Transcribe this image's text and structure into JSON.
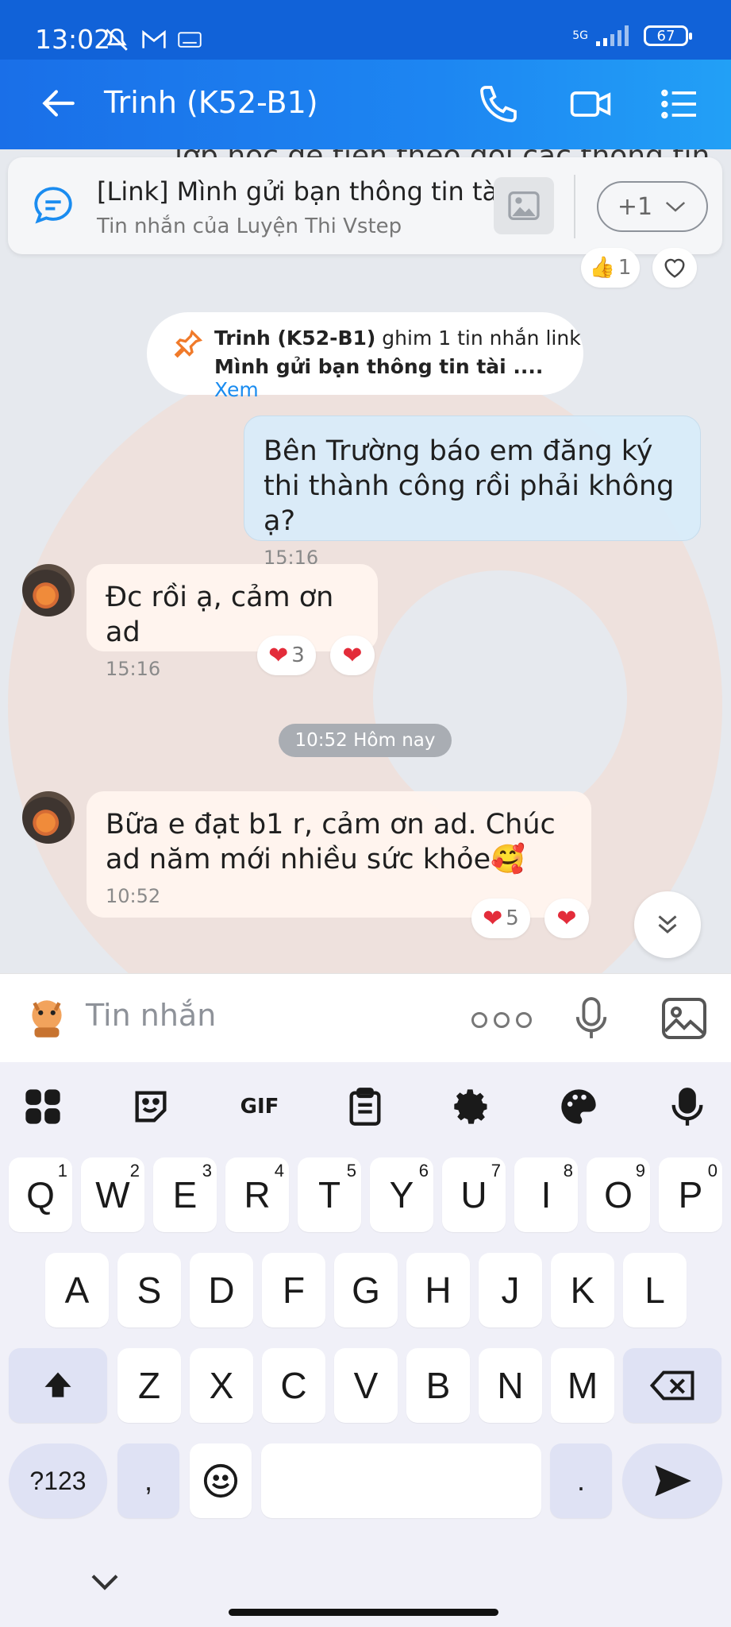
{
  "status_bar": {
    "time": "13:02",
    "network": "5G",
    "battery": "67"
  },
  "header": {
    "title": "Trinh (K52-B1)"
  },
  "chat": {
    "cut_off_text": "lớp học để tiện theo dõi các thông tin",
    "pinned": {
      "title": "[Link] Mình gửi bạn thông tin tà...",
      "subtitle": "Tin nhắn của Luyện Thi Vstep",
      "more_label": "+1"
    },
    "prev_reaction_count": "1",
    "pin_notice": {
      "actor": "Trinh (K52-B1)",
      "action": " ghim 1 tin nhắn link",
      "message": "Mình gửi bạn thông tin tài .... ",
      "link": "Xem"
    },
    "messages": [
      {
        "text": "Bên Trường báo em đăng ký thi thành công rồi phải không ạ?",
        "time": "15:16"
      },
      {
        "text": "Đc rồi ạ, cảm ơn ad",
        "time": "15:16",
        "reaction_count": "3"
      },
      {
        "text": "Bữa e đạt b1 r, cảm ơn ad. Chúc ad năm mới nhiều sức khỏe🥰",
        "time": "10:52",
        "reaction_count": "5"
      }
    ],
    "date_chip": "10:52 Hôm nay"
  },
  "composer": {
    "placeholder": "Tin nhắn"
  },
  "keyboard": {
    "toolbar": {
      "gif_label": "GIF"
    },
    "row1": [
      [
        "Q",
        "1"
      ],
      [
        "W",
        "2"
      ],
      [
        "E",
        "3"
      ],
      [
        "R",
        "4"
      ],
      [
        "T",
        "5"
      ],
      [
        "Y",
        "6"
      ],
      [
        "U",
        "7"
      ],
      [
        "I",
        "8"
      ],
      [
        "O",
        "9"
      ],
      [
        "P",
        "0"
      ]
    ],
    "row2": [
      "A",
      "S",
      "D",
      "F",
      "G",
      "H",
      "J",
      "K",
      "L"
    ],
    "row3": [
      "Z",
      "X",
      "C",
      "V",
      "B",
      "N",
      "M"
    ],
    "symbols_label": "?123",
    "comma": ",",
    "period": "."
  },
  "colors": {
    "header_start": "#1a6fe8",
    "header_end": "#22a0f6",
    "link": "#1a8cf0",
    "heart": "#e32c3a"
  }
}
